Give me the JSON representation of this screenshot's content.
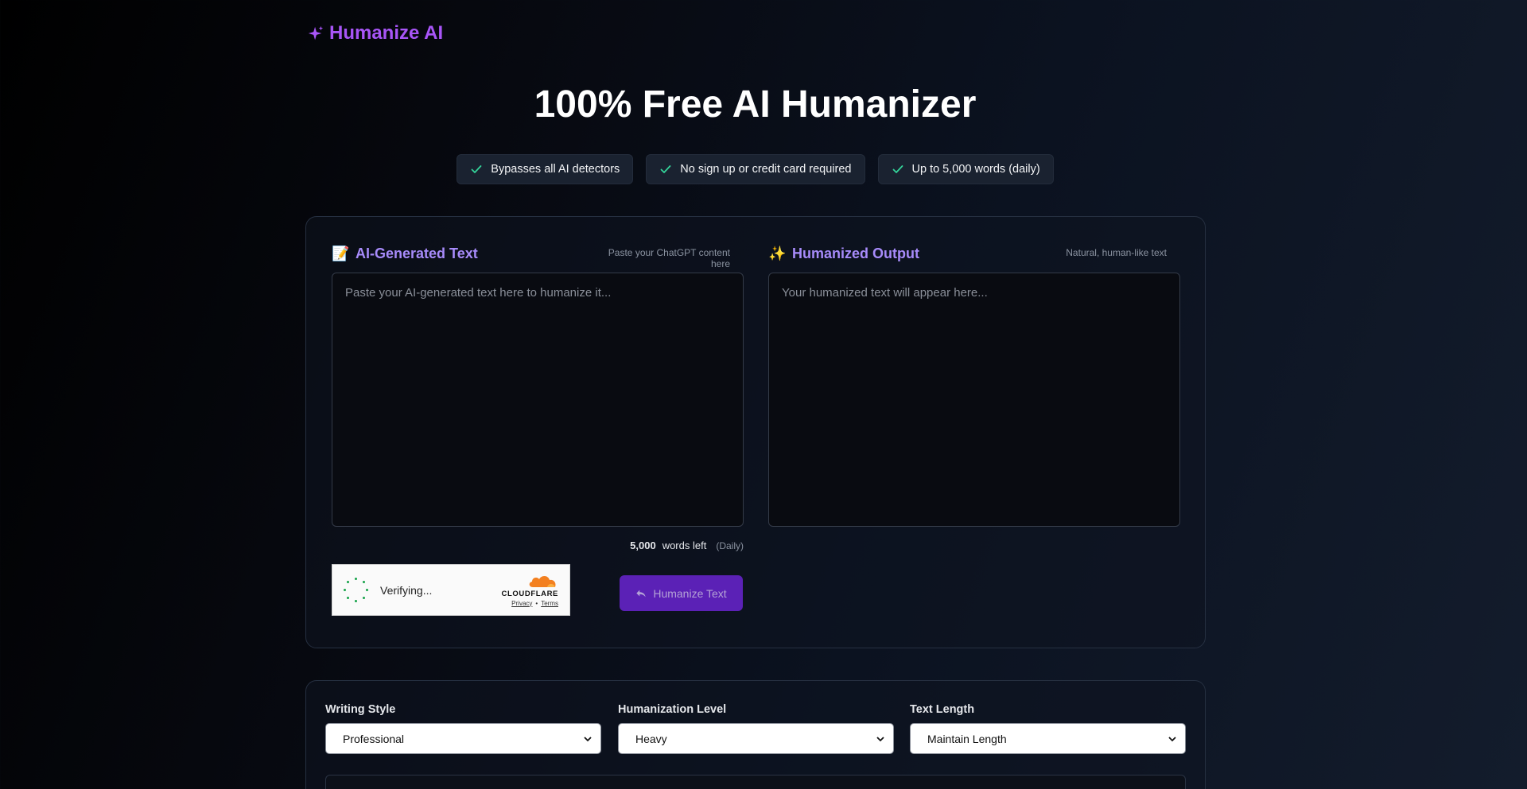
{
  "brand": {
    "name": "Humanize AI",
    "icon": "sparkle-icon",
    "accent": "#a855f7"
  },
  "headline": "100% Free AI Humanizer",
  "features": [
    {
      "icon": "check-icon",
      "label": "Bypasses all AI detectors"
    },
    {
      "icon": "check-icon",
      "label": "No sign up or credit card required"
    },
    {
      "icon": "check-icon",
      "label": "Up to 5,000 words (daily)"
    }
  ],
  "input_panel": {
    "icon": "memo-icon",
    "emoji": "📝",
    "title": "AI-Generated Text",
    "subtitle": "Paste your ChatGPT content here",
    "placeholder": "Paste your AI-generated text here to humanize it...",
    "value": ""
  },
  "output_panel": {
    "icon": "sparkles-icon",
    "emoji": "✨",
    "title": "Humanized Output",
    "subtitle": "Natural, human-like text",
    "placeholder": "Your humanized text will appear here...",
    "value": ""
  },
  "word_counter": {
    "count": "5,000",
    "label": "words left",
    "period": "(Daily)"
  },
  "captcha": {
    "status": "Verifying...",
    "provider": "CLOUDFLARE",
    "privacy": "Privacy",
    "separator": "•",
    "terms": "Terms"
  },
  "actions": {
    "humanize_label": "Humanize Text",
    "button_color": "#5b21b6"
  },
  "options": [
    {
      "label": "Writing Style",
      "selected": "Professional"
    },
    {
      "label": "Humanization Level",
      "selected": "Heavy"
    },
    {
      "label": "Text Length",
      "selected": "Maintain Length"
    }
  ],
  "colors": {
    "check": "#34d399",
    "title_purple": "#a78bfa",
    "cloudflare_orange": "#f38020"
  }
}
